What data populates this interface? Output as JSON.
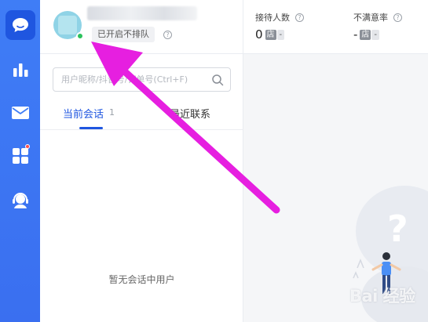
{
  "sidebar": {
    "items": [
      {
        "icon": "chat-bubble-icon",
        "active": true
      },
      {
        "icon": "bar-chart-icon"
      },
      {
        "icon": "mail-icon"
      },
      {
        "icon": "apps-grid-icon",
        "badge": true
      },
      {
        "icon": "customer-service-icon"
      }
    ]
  },
  "profile": {
    "status_label": "已开启不排队",
    "online_color": "#2bc25c"
  },
  "search": {
    "placeholder": "用户昵称/抖音号/订单号(Ctrl+F)"
  },
  "tabs": {
    "current_label": "当前会话",
    "current_count": "1",
    "recent_label": "最近联系"
  },
  "empty_state": {
    "text": "暂无会话中用户"
  },
  "stats": {
    "reception": {
      "label": "接待人数",
      "value": "0",
      "unit": "店",
      "dash": "-"
    },
    "dissatisfaction": {
      "label": "不满意率",
      "value": "-",
      "unit": "店",
      "dash": "-"
    }
  },
  "watermark": "Bai 经验",
  "colors": {
    "accent": "#1f56e0",
    "rail": "#3f7df6",
    "annotation_arrow": "#e61fe0"
  }
}
